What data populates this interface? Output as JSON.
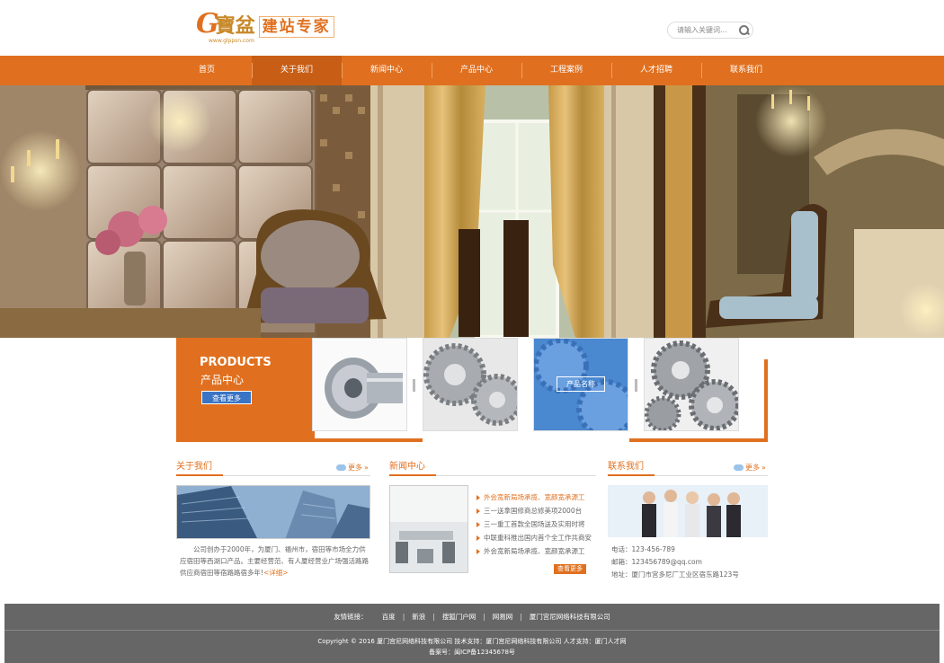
{
  "header": {
    "logo_g": "G",
    "logo_bao": "寶盆",
    "logo_text": "建站专家",
    "logo_url": "www.glppsn.com",
    "search_placeholder": "请输入关键词..."
  },
  "nav": {
    "items": [
      "首页",
      "关于我们",
      "新闻中心",
      "产品中心",
      "工程案例",
      "人才招聘",
      "联系我们"
    ],
    "active_index": 1
  },
  "products": {
    "title_en": "PRODUCTS",
    "title_cn": "产品中心",
    "more_button": "查看更多",
    "hover_label": "产品名称"
  },
  "about": {
    "title": "关于我们",
    "more": "更多",
    "text": "公司创办于2000年，为厦门、福州市，宿田等市场全力供应宿田等西湖口产品。主要经营范、有人厦经营业广场强活路路供应商宿田等宿路路宿多年!",
    "detail_link": "<详细>"
  },
  "news": {
    "title": "新闻中心",
    "more_button": "查看更多",
    "items": [
      "外会宽新局场承揽、宽颜宽承源工",
      "三一送拿国修商总修美项2000台",
      "三一重工首款全国场送及实用时将",
      "中联重科推出国内首个全工作共商安",
      "外会宽新局场承揽、宽颜宽承源工"
    ]
  },
  "contact": {
    "title": "联系我们",
    "more": "更多",
    "phone": "电话：123-456-789",
    "email": "邮箱：123456789@qq.com",
    "address": "地址：厦门市宫多尼厂工业区宿东路123号"
  },
  "footer": {
    "links": [
      "友情链接：",
      "百度",
      "新浪",
      "搜狐门户网",
      "网易网",
      "厦门宫尼网络科技有限公司"
    ],
    "copyright_line1": "Copyright © 2016 厦门宫尼网络科技有限公司 技术支持：厦门宫尼网络科技有限公司 人才支持：厦门人才网",
    "copyright_line2": "备案号：闽ICP备12345678号"
  },
  "colors": {
    "brand_orange": "#e0701f",
    "nav_active": "#c85e15",
    "footer_gray": "#666666",
    "button_blue": "#3a74c4"
  }
}
